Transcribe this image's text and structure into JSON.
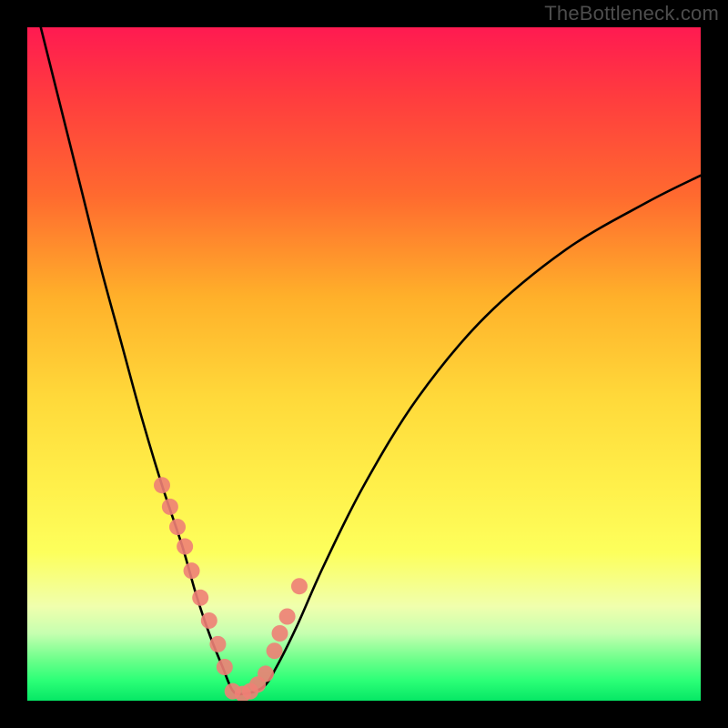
{
  "watermark": "TheBottleneck.com",
  "chart_data": {
    "type": "line",
    "title": "",
    "xlabel": "",
    "ylabel": "",
    "xlim": [
      0,
      100
    ],
    "ylim": [
      0,
      100
    ],
    "series": [
      {
        "name": "bottleneck-curve",
        "x": [
          2,
          5,
          8,
          11,
          14,
          17,
          20,
          23,
          25,
          27,
          29,
          30.5,
          32,
          35,
          37,
          40,
          44,
          50,
          58,
          68,
          80,
          92,
          100
        ],
        "y": [
          100,
          88,
          76,
          64,
          53,
          42,
          32,
          23,
          16,
          10,
          5,
          1.5,
          1,
          2,
          5,
          11,
          20,
          32,
          45,
          57,
          67,
          74,
          78
        ]
      }
    ],
    "scatter_points": {
      "name": "highlighted-points",
      "color": "#ee8076",
      "x": [
        20.0,
        21.2,
        22.3,
        23.4,
        24.4,
        25.7,
        27.0,
        28.3,
        29.3,
        30.5,
        32.0,
        33.1,
        34.2,
        35.4,
        36.7,
        37.5,
        38.6,
        40.4
      ],
      "y": [
        32.0,
        28.8,
        25.8,
        22.9,
        19.3,
        15.3,
        11.9,
        8.4,
        5.0,
        1.4,
        1.0,
        1.4,
        2.4,
        4.0,
        7.4,
        10.0,
        12.5,
        17.0
      ]
    }
  }
}
